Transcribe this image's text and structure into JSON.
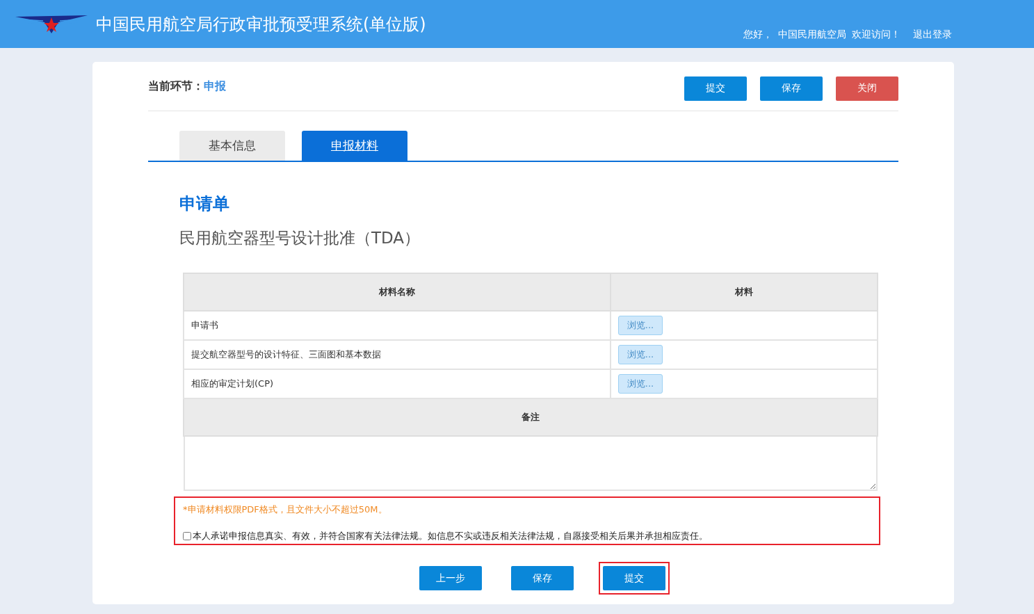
{
  "header": {
    "title": "中国民用航空局行政审批预受理系统(单位版)",
    "greeting": "您好，",
    "user": "中国民用航空局",
    "welcome": "欢迎访问！",
    "logout": "退出登录"
  },
  "stage": {
    "label": "当前环节：",
    "value": "申报"
  },
  "top_buttons": [
    {
      "label": "提交",
      "kind": "primary"
    },
    {
      "label": "保存",
      "kind": "primary"
    },
    {
      "label": "关闭",
      "kind": "danger"
    }
  ],
  "tabs": [
    {
      "label": "基本信息",
      "selected": false
    },
    {
      "label": "申报材料",
      "selected": true
    }
  ],
  "form": {
    "title": "申请单",
    "subtitle": "民用航空器型号设计批准（TDA）"
  },
  "table": {
    "columns": [
      "材料名称",
      "材料"
    ],
    "rows": [
      {
        "name": "申请书",
        "button": "浏览..."
      },
      {
        "name": "提交航空器型号的设计特征、三面图和基本数据",
        "button": "浏览..."
      },
      {
        "name": "相应的审定计划(CP)",
        "button": "浏览..."
      }
    ],
    "remarks_heading": "备注"
  },
  "notice": "*申请材料权限PDF格式，且文件大小不超过50M。",
  "pledge": {
    "text": "本人承诺申报信息真实、有效，并符合国家有关法律法规。如信息不实或违反相关法律法规，自愿接受相关后果并承担相应责任。",
    "checked": false
  },
  "bottom_buttons": [
    {
      "label": "上一步",
      "highlighted": false
    },
    {
      "label": "保存",
      "highlighted": false
    },
    {
      "label": "提交",
      "highlighted": true
    }
  ]
}
